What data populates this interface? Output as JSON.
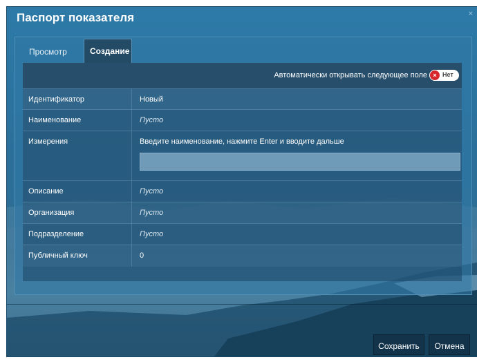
{
  "dialog": {
    "title": "Паспорт показателя",
    "close_label": "×"
  },
  "tabs": [
    {
      "label": "Просмотр",
      "active": false
    },
    {
      "label": "Создание",
      "active": true
    }
  ],
  "autobar": {
    "label": "Автоматически открывать следующее поле",
    "toggle_icon": "×",
    "toggle_text": "Нет",
    "toggle_on": false
  },
  "rows": [
    {
      "label": "Идентификатор",
      "value": "Новый"
    },
    {
      "label": "Наименование",
      "value": "Пусто"
    },
    {
      "label": "Измерения",
      "value": "Введите наименование, нажмите Enter и вводите дальше",
      "input_value": ""
    },
    {
      "label": "Описание",
      "value": "Пусто"
    },
    {
      "label": "Организация",
      "value": "Пусто"
    },
    {
      "label": "Подразделение",
      "value": "Пусто"
    },
    {
      "label": "Публичный ключ",
      "value": "0"
    }
  ],
  "footer": {
    "save_label": "Сохранить",
    "cancel_label": "Отмена"
  },
  "colors": {
    "dialog_bg": "#2d7aa8",
    "button_bg": "#12334a",
    "toggle_off": "#d6262b"
  }
}
